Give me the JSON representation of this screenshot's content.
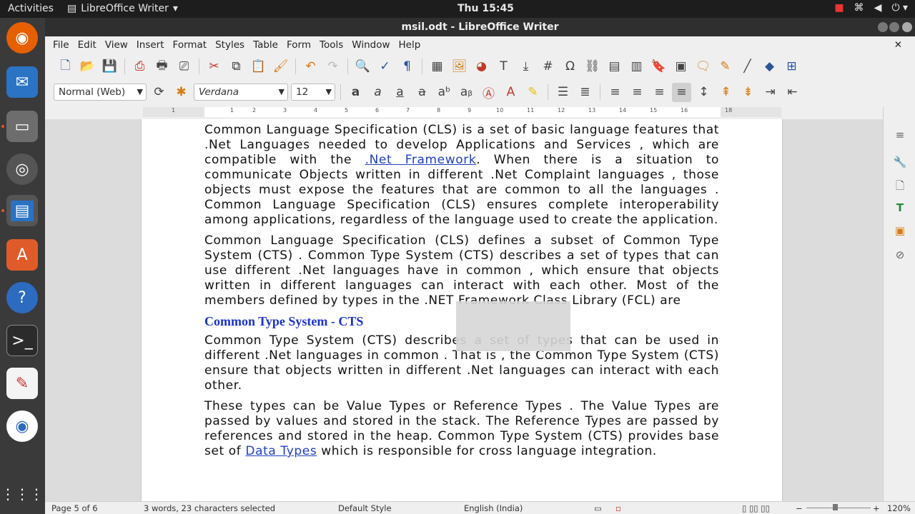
{
  "topbar": {
    "activities": "Activities",
    "app_name": "LibreOffice Writer",
    "clock": "Thu 15:45"
  },
  "window": {
    "title": "msil.odt - LibreOffice Writer"
  },
  "menu": [
    "File",
    "Edit",
    "View",
    "Insert",
    "Format",
    "Styles",
    "Table",
    "Form",
    "Tools",
    "Window",
    "Help"
  ],
  "format": {
    "paragraph_style": "Normal (Web)",
    "font_name": "Verdana",
    "font_size": "12"
  },
  "ruler_numbers": [
    "1",
    "1",
    "2",
    "3",
    "4",
    "5",
    "6",
    "7",
    "8",
    "9",
    "10",
    "11",
    "12",
    "13",
    "14",
    "15",
    "16",
    "18"
  ],
  "document": {
    "p1_a": "Common Language Specification (CLS) is a set of basic language features that .Net Languages needed to develop Applications and Services , which are compatible with the ",
    "p1_link": ".Net Framework",
    "p1_b": ". When there is a situation to communicate Objects written in different .Net Complaint languages , those objects must expose the features that are common to all the languages . Common Language Specification (CLS) ensures complete interoperability among applications, regardless of the language used to create the application.",
    "p2": "Common Language Specification (CLS) defines a subset of Common Type System (CTS) . Common Type System (CTS) describes a set of types that can use different .Net languages have in common , which ensure that objects written in different languages can interact with each other. Most of the members defined by types in the .NET Framework Class Library (FCL) are",
    "heading1": "Common Type System - CTS",
    "p3": "Common Type System (CTS) describes a set of types that can be used in different .Net languages in common . That is , the Common Type System (CTS) ensure that objects written in different .Net languages can interact with each other.",
    "p4_a": "These types can be Value Types or Reference Types . The Value Types are passed by values and stored in the stack. The Reference Types are passed by references and stored in the heap. Common Type System (CTS) provides base set of ",
    "p4_link": "Data Types",
    "p4_b": " which is responsible for cross language integration."
  },
  "status": {
    "page": "Page 5 of 6",
    "selection": "3 words, 23 characters selected",
    "page_style": "Default Style",
    "language": "English (India)",
    "zoom": "120%"
  }
}
